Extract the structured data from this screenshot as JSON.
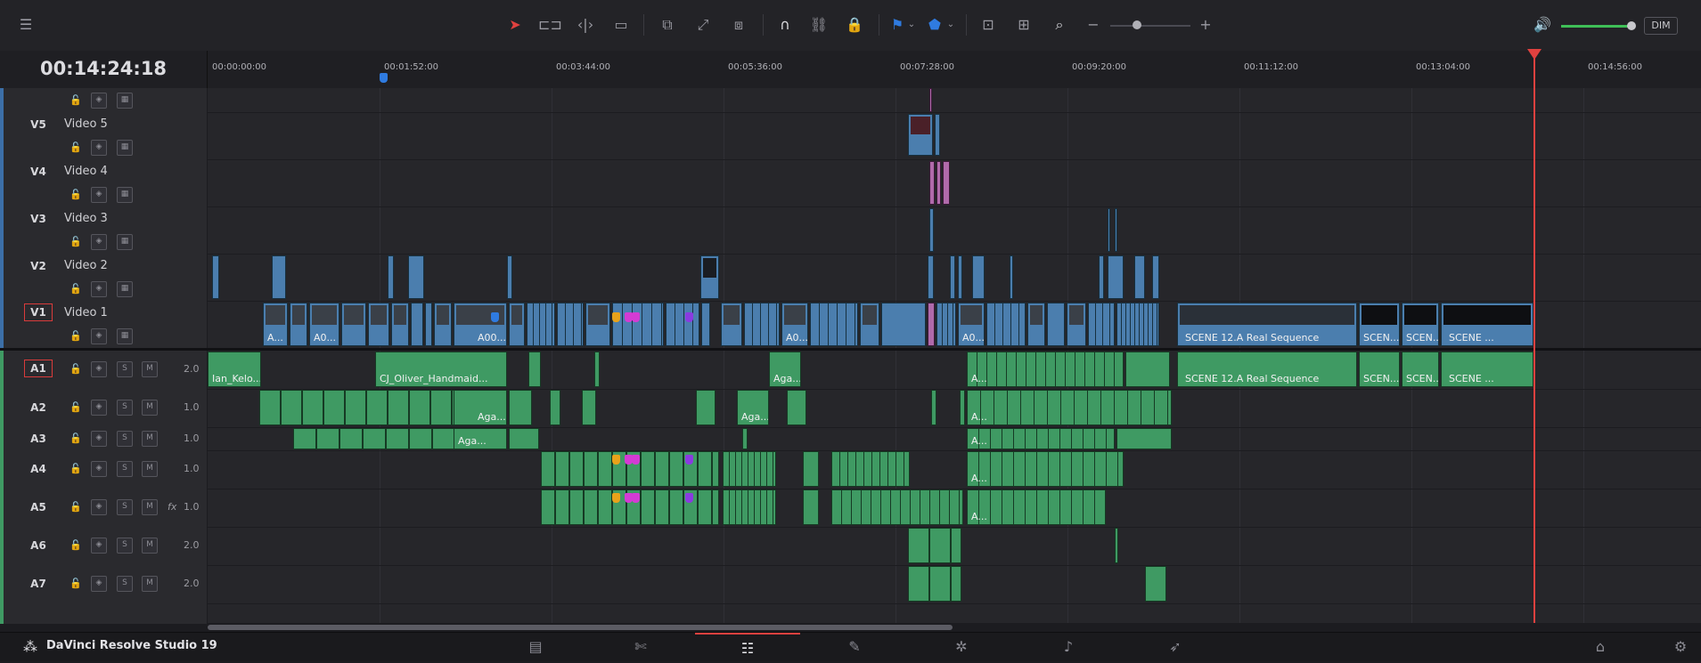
{
  "timecode": "00:14:24:18",
  "ruler": {
    "labels": [
      "00:00:00:00",
      "00:01:52:00",
      "00:03:44:00",
      "00:05:36:00",
      "00:07:28:00",
      "00:09:20:00",
      "00:11:12:00",
      "00:13:04:00",
      "00:14:56:00"
    ]
  },
  "toolbar": {
    "dim_label": "DIM"
  },
  "tracks": {
    "video": [
      {
        "id": "V5",
        "name": "Video 5"
      },
      {
        "id": "V4",
        "name": "Video 4"
      },
      {
        "id": "V3",
        "name": "Video 3"
      },
      {
        "id": "V2",
        "name": "Video 2"
      },
      {
        "id": "V1",
        "name": "Video 1"
      }
    ],
    "audio": [
      {
        "id": "A1",
        "vol": "2.0",
        "fx": ""
      },
      {
        "id": "A2",
        "vol": "1.0",
        "fx": ""
      },
      {
        "id": "A3",
        "vol": "1.0",
        "fx": ""
      },
      {
        "id": "A4",
        "vol": "1.0",
        "fx": ""
      },
      {
        "id": "A5",
        "vol": "1.0",
        "fx": "fx"
      },
      {
        "id": "A6",
        "vol": "2.0",
        "fx": ""
      },
      {
        "id": "A7",
        "vol": "2.0",
        "fx": ""
      }
    ],
    "solo_label": "S",
    "mute_label": "M"
  },
  "clips": {
    "v1_a1": "A...",
    "v1_a0": "A0...",
    "v1_a00": "A00...",
    "v1_a0b": "A0...",
    "v1_a0c": "A0...",
    "scene_main": "SCENE 12.A Real Sequence",
    "scene_short1": "SCEN...",
    "scene_short2": "SCEN...",
    "scene_short3": "SCENE ...",
    "a1_ian": "Ian_Kelo...",
    "a1_cj": "CJ_Oliver_Handmaid...",
    "a1_aga": "Aga...",
    "a1_a": "A...",
    "a1_scene_main": "SCENE 12.A Real Sequence",
    "a1_scene_s1": "SCEN...",
    "a1_scene_s2": "SCEN...",
    "a1_scene_s3": "SCENE ...",
    "a2_aga1": "Aga...",
    "a2_aga2": "Aga...",
    "a2_a": "A...",
    "a3_aga": "Aga...",
    "a3_a": "A...",
    "a4_a": "A...",
    "a5_a": "A..."
  },
  "bottom": {
    "app_name": "DaVinci Resolve Studio 19"
  },
  "colors": {
    "video_clip": "#4b7eae",
    "audio_clip": "#3f9a63",
    "playhead": "#e0413f",
    "marker_blue": "#2f7be0",
    "marker_orange": "#e8a21a",
    "marker_magenta": "#d43bd4",
    "marker_purple": "#8a3be0"
  }
}
